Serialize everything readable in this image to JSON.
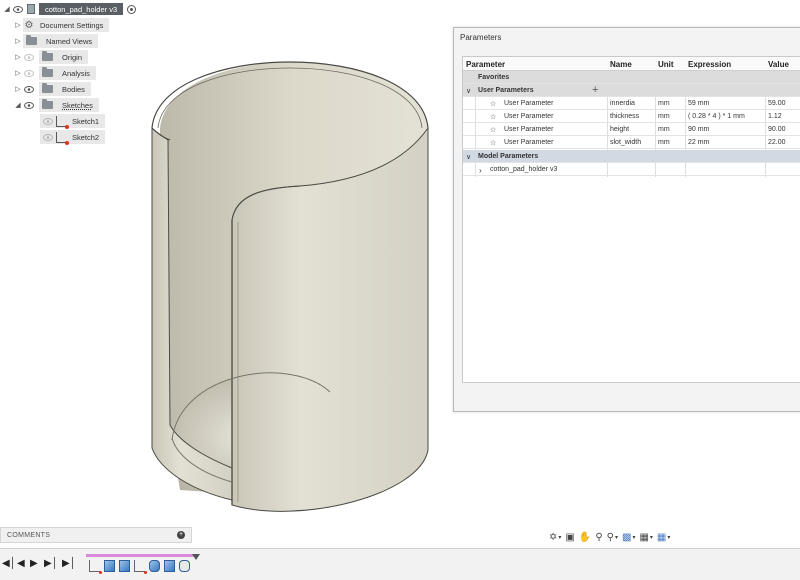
{
  "browser": {
    "root": "cotton_pad_holder v3",
    "items": [
      {
        "label": "Document Settings"
      },
      {
        "label": "Named Views"
      },
      {
        "label": "Origin"
      },
      {
        "label": "Analysis"
      },
      {
        "label": "Bodies"
      },
      {
        "label": "Sketches"
      }
    ],
    "sketches": [
      "Sketch1",
      "Sketch2"
    ]
  },
  "parameters": {
    "title": "Parameters",
    "columns": [
      "Parameter",
      "Name",
      "Unit",
      "Expression",
      "Value"
    ],
    "favorites_label": "Favorites",
    "user_group_label": "User Parameters",
    "user_rows": [
      {
        "parameter": "User Parameter",
        "name": "innerdia",
        "unit": "mm",
        "expression": "59 mm",
        "value": "59.00"
      },
      {
        "parameter": "User Parameter",
        "name": "thickness",
        "unit": "mm",
        "expression": "( 0.28 * 4 ) * 1 mm",
        "value": "1.12"
      },
      {
        "parameter": "User Parameter",
        "name": "height",
        "unit": "mm",
        "expression": "90 mm",
        "value": "90.00"
      },
      {
        "parameter": "User Parameter",
        "name": "slot_width",
        "unit": "mm",
        "expression": "22 mm",
        "value": "22.00"
      }
    ],
    "model_group_label": "Model Parameters",
    "model_rows": [
      {
        "parameter": "cotton_pad_holder v3"
      }
    ]
  },
  "comments": {
    "label": "COMMENTS"
  },
  "colors": {
    "model_face": "#dedbd0",
    "model_edge": "#4a4a44",
    "background": "#ffffff",
    "timeline_marker": "#d98ad9"
  }
}
